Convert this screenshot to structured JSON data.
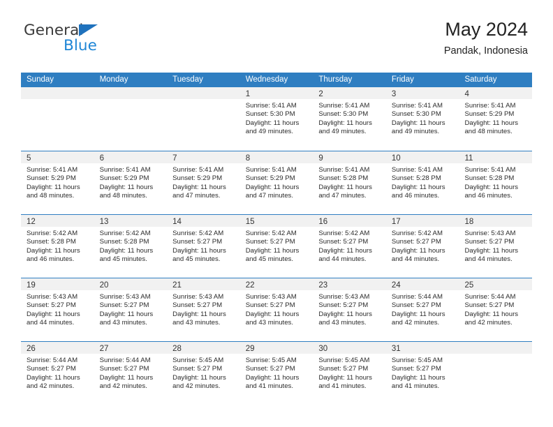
{
  "brand": {
    "name_top": "General",
    "name_bottom": "Blue",
    "accent_color": "#1f86d6",
    "triangle_color": "#1f72bd"
  },
  "header": {
    "title": "May 2024",
    "subtitle": "Pandak, Indonesia"
  },
  "calendar": {
    "header_bg": "#2f7ec1",
    "daynumber_bg": "#f1f1f1",
    "weekdays": [
      "Sunday",
      "Monday",
      "Tuesday",
      "Wednesday",
      "Thursday",
      "Friday",
      "Saturday"
    ],
    "weeks": [
      [
        {
          "day": "",
          "empty": true
        },
        {
          "day": "",
          "empty": true
        },
        {
          "day": "",
          "empty": true
        },
        {
          "day": "1",
          "sunrise": "Sunrise: 5:41 AM",
          "sunset": "Sunset: 5:30 PM",
          "daylight": "Daylight: 11 hours and 49 minutes."
        },
        {
          "day": "2",
          "sunrise": "Sunrise: 5:41 AM",
          "sunset": "Sunset: 5:30 PM",
          "daylight": "Daylight: 11 hours and 49 minutes."
        },
        {
          "day": "3",
          "sunrise": "Sunrise: 5:41 AM",
          "sunset": "Sunset: 5:30 PM",
          "daylight": "Daylight: 11 hours and 49 minutes."
        },
        {
          "day": "4",
          "sunrise": "Sunrise: 5:41 AM",
          "sunset": "Sunset: 5:29 PM",
          "daylight": "Daylight: 11 hours and 48 minutes."
        }
      ],
      [
        {
          "day": "5",
          "sunrise": "Sunrise: 5:41 AM",
          "sunset": "Sunset: 5:29 PM",
          "daylight": "Daylight: 11 hours and 48 minutes."
        },
        {
          "day": "6",
          "sunrise": "Sunrise: 5:41 AM",
          "sunset": "Sunset: 5:29 PM",
          "daylight": "Daylight: 11 hours and 48 minutes."
        },
        {
          "day": "7",
          "sunrise": "Sunrise: 5:41 AM",
          "sunset": "Sunset: 5:29 PM",
          "daylight": "Daylight: 11 hours and 47 minutes."
        },
        {
          "day": "8",
          "sunrise": "Sunrise: 5:41 AM",
          "sunset": "Sunset: 5:29 PM",
          "daylight": "Daylight: 11 hours and 47 minutes."
        },
        {
          "day": "9",
          "sunrise": "Sunrise: 5:41 AM",
          "sunset": "Sunset: 5:28 PM",
          "daylight": "Daylight: 11 hours and 47 minutes."
        },
        {
          "day": "10",
          "sunrise": "Sunrise: 5:41 AM",
          "sunset": "Sunset: 5:28 PM",
          "daylight": "Daylight: 11 hours and 46 minutes."
        },
        {
          "day": "11",
          "sunrise": "Sunrise: 5:41 AM",
          "sunset": "Sunset: 5:28 PM",
          "daylight": "Daylight: 11 hours and 46 minutes."
        }
      ],
      [
        {
          "day": "12",
          "sunrise": "Sunrise: 5:42 AM",
          "sunset": "Sunset: 5:28 PM",
          "daylight": "Daylight: 11 hours and 46 minutes."
        },
        {
          "day": "13",
          "sunrise": "Sunrise: 5:42 AM",
          "sunset": "Sunset: 5:28 PM",
          "daylight": "Daylight: 11 hours and 45 minutes."
        },
        {
          "day": "14",
          "sunrise": "Sunrise: 5:42 AM",
          "sunset": "Sunset: 5:27 PM",
          "daylight": "Daylight: 11 hours and 45 minutes."
        },
        {
          "day": "15",
          "sunrise": "Sunrise: 5:42 AM",
          "sunset": "Sunset: 5:27 PM",
          "daylight": "Daylight: 11 hours and 45 minutes."
        },
        {
          "day": "16",
          "sunrise": "Sunrise: 5:42 AM",
          "sunset": "Sunset: 5:27 PM",
          "daylight": "Daylight: 11 hours and 44 minutes."
        },
        {
          "day": "17",
          "sunrise": "Sunrise: 5:42 AM",
          "sunset": "Sunset: 5:27 PM",
          "daylight": "Daylight: 11 hours and 44 minutes."
        },
        {
          "day": "18",
          "sunrise": "Sunrise: 5:43 AM",
          "sunset": "Sunset: 5:27 PM",
          "daylight": "Daylight: 11 hours and 44 minutes."
        }
      ],
      [
        {
          "day": "19",
          "sunrise": "Sunrise: 5:43 AM",
          "sunset": "Sunset: 5:27 PM",
          "daylight": "Daylight: 11 hours and 44 minutes."
        },
        {
          "day": "20",
          "sunrise": "Sunrise: 5:43 AM",
          "sunset": "Sunset: 5:27 PM",
          "daylight": "Daylight: 11 hours and 43 minutes."
        },
        {
          "day": "21",
          "sunrise": "Sunrise: 5:43 AM",
          "sunset": "Sunset: 5:27 PM",
          "daylight": "Daylight: 11 hours and 43 minutes."
        },
        {
          "day": "22",
          "sunrise": "Sunrise: 5:43 AM",
          "sunset": "Sunset: 5:27 PM",
          "daylight": "Daylight: 11 hours and 43 minutes."
        },
        {
          "day": "23",
          "sunrise": "Sunrise: 5:43 AM",
          "sunset": "Sunset: 5:27 PM",
          "daylight": "Daylight: 11 hours and 43 minutes."
        },
        {
          "day": "24",
          "sunrise": "Sunrise: 5:44 AM",
          "sunset": "Sunset: 5:27 PM",
          "daylight": "Daylight: 11 hours and 42 minutes."
        },
        {
          "day": "25",
          "sunrise": "Sunrise: 5:44 AM",
          "sunset": "Sunset: 5:27 PM",
          "daylight": "Daylight: 11 hours and 42 minutes."
        }
      ],
      [
        {
          "day": "26",
          "sunrise": "Sunrise: 5:44 AM",
          "sunset": "Sunset: 5:27 PM",
          "daylight": "Daylight: 11 hours and 42 minutes."
        },
        {
          "day": "27",
          "sunrise": "Sunrise: 5:44 AM",
          "sunset": "Sunset: 5:27 PM",
          "daylight": "Daylight: 11 hours and 42 minutes."
        },
        {
          "day": "28",
          "sunrise": "Sunrise: 5:45 AM",
          "sunset": "Sunset: 5:27 PM",
          "daylight": "Daylight: 11 hours and 42 minutes."
        },
        {
          "day": "29",
          "sunrise": "Sunrise: 5:45 AM",
          "sunset": "Sunset: 5:27 PM",
          "daylight": "Daylight: 11 hours and 41 minutes."
        },
        {
          "day": "30",
          "sunrise": "Sunrise: 5:45 AM",
          "sunset": "Sunset: 5:27 PM",
          "daylight": "Daylight: 11 hours and 41 minutes."
        },
        {
          "day": "31",
          "sunrise": "Sunrise: 5:45 AM",
          "sunset": "Sunset: 5:27 PM",
          "daylight": "Daylight: 11 hours and 41 minutes."
        },
        {
          "day": "",
          "empty": true
        }
      ]
    ]
  }
}
